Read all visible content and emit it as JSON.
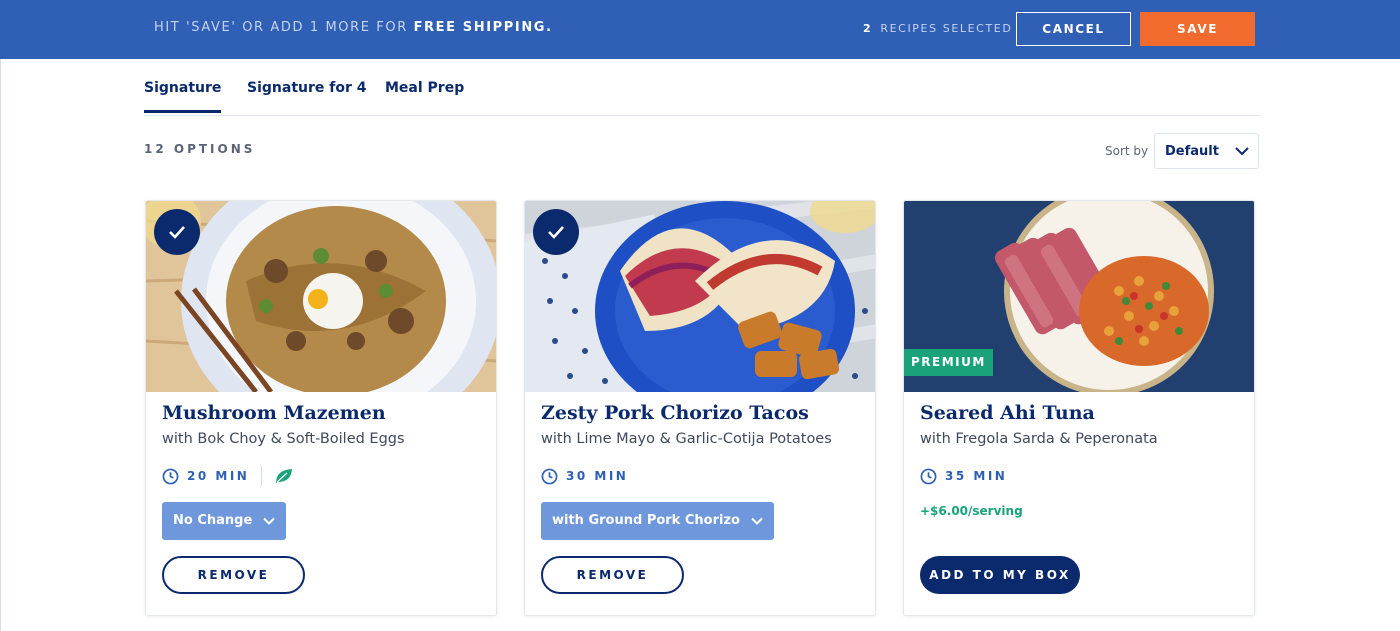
{
  "banner": {
    "message_prefix": "HIT 'SAVE' OR ADD 1 MORE FOR ",
    "message_emphasis": "FREE SHIPPING.",
    "selected_count": "2",
    "selected_label": "RECIPES SELECTED",
    "cancel_label": "CANCEL",
    "save_label": "SAVE"
  },
  "tabs": [
    {
      "label": "Signature",
      "active": true
    },
    {
      "label": "Signature for 4",
      "active": false
    },
    {
      "label": "Meal Prep",
      "active": false
    }
  ],
  "listing": {
    "options_count": "12 OPTIONS",
    "sort_label": "Sort by",
    "sort_value": "Default"
  },
  "cards": [
    {
      "title": "Mushroom Mazemen",
      "subtitle": "with Bok Choy & Soft-Boiled Eggs",
      "time": "20 MIN",
      "selected": true,
      "vegetarian": true,
      "dropdown": "No Change",
      "action": "REMOVE"
    },
    {
      "title": "Zesty Pork Chorizo Tacos",
      "subtitle": "with Lime Mayo & Garlic-Cotija Potatoes",
      "time": "30 MIN",
      "selected": true,
      "dropdown": "with Ground Pork Chorizo",
      "action": "REMOVE"
    },
    {
      "title": "Seared Ahi Tuna",
      "subtitle": "with Fregola Sarda & Peperonata",
      "time": "35 MIN",
      "selected": false,
      "badge": "PREMIUM",
      "price": "+$6.00/serving",
      "action": "ADD TO MY BOX"
    }
  ],
  "colors": {
    "banner_bg": "#2f60b5",
    "save_bg": "#f26b2e",
    "navy": "#0b2a6e",
    "premium_green": "#1aa37a",
    "dropdown_bg": "#6f97dc"
  },
  "icons": [
    "check-icon",
    "clock-icon",
    "leaf-icon",
    "chevron-down-icon"
  ]
}
